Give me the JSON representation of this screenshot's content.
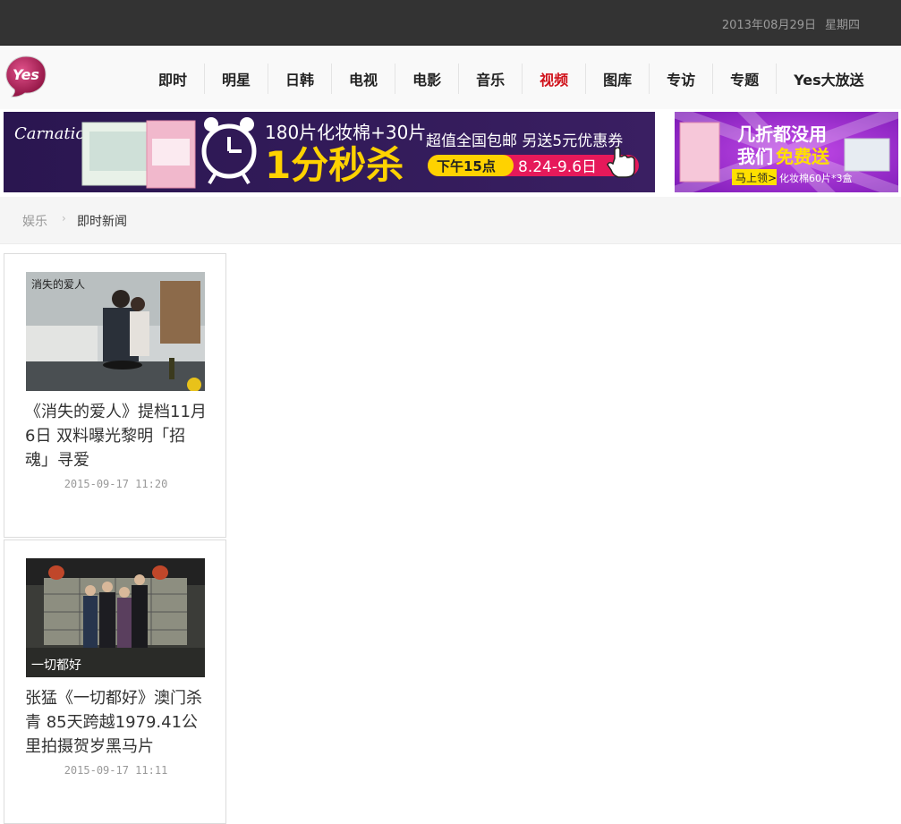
{
  "topbar": {
    "date": "2013年08月29日",
    "weekday": "星期四"
  },
  "logo": {
    "text": "Yes"
  },
  "nav": {
    "items": [
      {
        "label": "即时"
      },
      {
        "label": "明星"
      },
      {
        "label": "日韩"
      },
      {
        "label": "电视"
      },
      {
        "label": "电影"
      },
      {
        "label": "音乐"
      },
      {
        "label": "视频",
        "active": true
      },
      {
        "label": "图库"
      },
      {
        "label": "专访"
      },
      {
        "label": "专题"
      },
      {
        "label": "Yes大放送"
      }
    ],
    "active_color": "#d0121b"
  },
  "banner_left": {
    "brand": "Carnation",
    "headline": "180片化妆棉+30片",
    "big_text": "1分秒杀",
    "right_top": "超值全国包邮  另送5元优惠券",
    "time_label": "下午15点",
    "date_range": "8.24-9.6日"
  },
  "banner_right": {
    "line1": "几折都没用",
    "line2_a": "我们",
    "line2_b": "免费送",
    "cta": "马上领>",
    "detail": "化妆棉60片*3盒"
  },
  "breadcrumb": {
    "root": "娱乐",
    "separator": "›",
    "current": "即时新闻"
  },
  "articles": [
    {
      "title": "《消失的爱人》提档11月6日 双料曝光黎明「招魂」寻爱",
      "time": "2015-09-17 11:20",
      "thumb_caption": "消失的爱人"
    },
    {
      "title": "张猛《一切都好》澳门杀青 85天跨越1979.41公里拍摄贺岁黑马片",
      "time": "2015-09-17 11:11",
      "thumb_caption": "一切都好"
    }
  ]
}
